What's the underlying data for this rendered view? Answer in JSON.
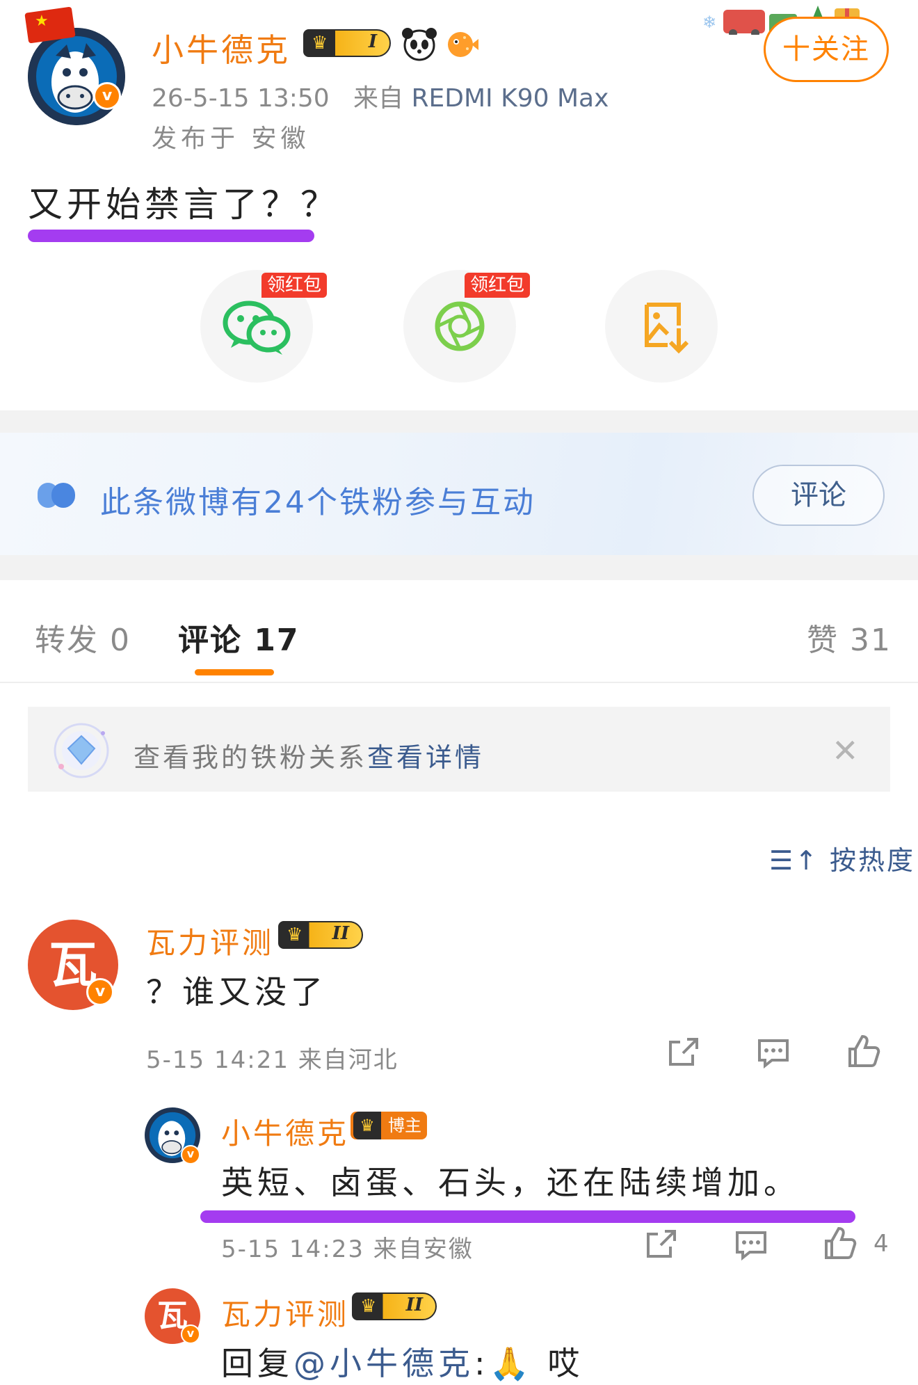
{
  "post": {
    "author": "小牛德克",
    "level": "I",
    "timestamp": "26-5-15 13:50",
    "source_prefix": "来自",
    "device": "REDMI K90 Max",
    "location": "发布于 安徽",
    "follow_label": "十关注",
    "content": "又开始禁言了？？"
  },
  "share": {
    "wechat_tag": "领红包",
    "moments_tag": "领红包",
    "icons": [
      "wechat-icon",
      "moments-icon",
      "save-image-icon"
    ]
  },
  "fans_banner": {
    "text": "此条微博有24个铁粉参与互动",
    "button": "评论"
  },
  "tabs": {
    "repost": "转发 0",
    "comment": "评论 17",
    "like": "赞 31"
  },
  "fan_relation": {
    "text": "查看我的铁粉关系",
    "link": "查看详情"
  },
  "sort_label": "按热度",
  "comments": [
    {
      "avatar_char": "瓦",
      "name": "瓦力评测",
      "level": "II",
      "text": "？谁又没了",
      "meta": "5-15 14:21 来自河北"
    },
    {
      "name": "小牛德克",
      "badge": "博主",
      "text": "英短、卤蛋、石头，还在陆续增加。",
      "meta": "5-15 14:23 来自安徽",
      "likes": "4"
    },
    {
      "avatar_char": "瓦",
      "name": "瓦力评测",
      "level": "II",
      "reply_prefix": "回复",
      "reply_target": "@小牛德克",
      "reply_body": ":🙏 哎"
    }
  ],
  "colors": {
    "brand_orange": "#ff8200",
    "name_orange": "#f07b12",
    "highlight_purple": "#a43cf0",
    "link_blue": "#3b5b8e",
    "fan_blue": "#4a7ed6"
  }
}
